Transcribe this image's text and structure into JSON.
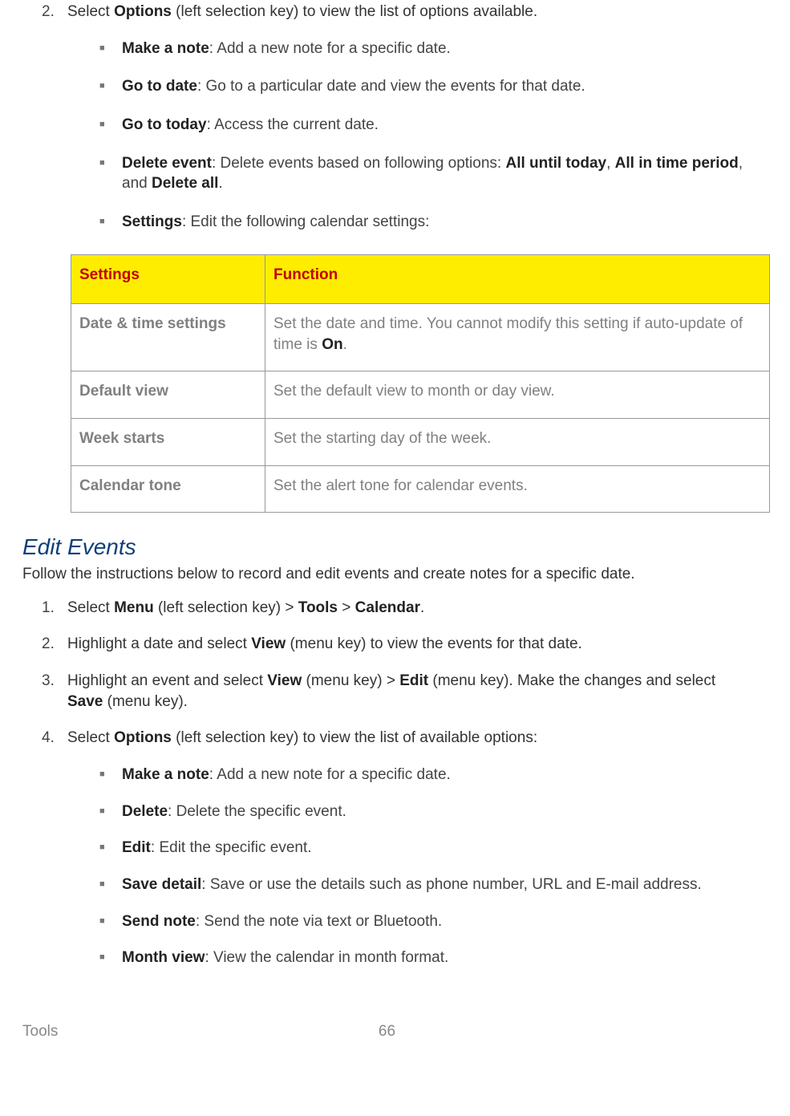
{
  "top": {
    "num": "2.",
    "lead1": "Select ",
    "options": "Options",
    "lead2": " (left selection key) to view the list of options available.",
    "bullets": [
      {
        "b": "Make a note",
        "t": ": Add a new note for a specific date."
      },
      {
        "b": "Go to date",
        "t": ": Go to a particular date and view the events for that date."
      },
      {
        "b": "Go to today",
        "t": ": Access the current date."
      }
    ],
    "del": {
      "b": "Delete event",
      "t1": ": Delete events based on following options: ",
      "o1": "All until today",
      "c1": ", ",
      "o2": "All in time period",
      "c2": ", and ",
      "o3": "Delete all",
      "c3": "."
    },
    "settings": {
      "b": "Settings",
      "t": ": Edit the following calendar settings:"
    }
  },
  "table": {
    "h1": "Settings",
    "h2": "Function",
    "rows": [
      {
        "s": "Date & time settings",
        "f1": "Set the date and time. You cannot modify this setting if auto-update of time is ",
        "on": "On",
        "f2": "."
      },
      {
        "s": "Default view",
        "f": "Set the default view to month or day view."
      },
      {
        "s": "Week starts",
        "f": "Set the starting day of the week."
      },
      {
        "s": "Calendar tone",
        "f": "Set the alert tone for calendar events."
      }
    ]
  },
  "h2": "Edit Events",
  "intro": "Follow the instructions below to record and edit events and create notes for a specific date.",
  "steps": {
    "s1": {
      "n": "1.",
      "t1": "Select ",
      "b1": "Menu",
      "t2": " (left selection key) > ",
      "b2": "Tools",
      "t3": " > ",
      "b3": "Calendar",
      "t4": "."
    },
    "s2": {
      "n": "2.",
      "t1": "Highlight a date and select ",
      "b1": "View",
      "t2": " (menu key) to view the events for that date."
    },
    "s3": {
      "n": "3.",
      "t1": "Highlight an event and select ",
      "b1": "View",
      "t2": " (menu key) > ",
      "b2": "Edit",
      "t3": " (menu key). Make the changes and select ",
      "b3": "Save",
      "t4": " (menu key)."
    },
    "s4": {
      "n": "4.",
      "t1": "Select ",
      "b1": "Options",
      "t2": " (left selection key) to view the list of available options:"
    },
    "opts": [
      {
        "b": "Make a note",
        "t": ": Add a new note for a specific date."
      },
      {
        "b": "Delete",
        "t": ": Delete the specific event."
      },
      {
        "b": "Edit",
        "t": ": Edit the specific event."
      },
      {
        "b": "Save detail",
        "t": ": Save or use the details such as phone number, URL and E-mail address."
      },
      {
        "b": "Send note",
        "t": ": Send the note via text or Bluetooth."
      },
      {
        "b": "Month view",
        "t": ": View the calendar in month format."
      }
    ]
  },
  "footer": {
    "left": "Tools",
    "center": "66"
  }
}
